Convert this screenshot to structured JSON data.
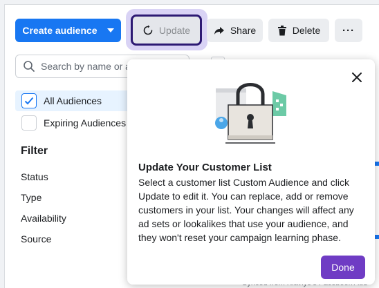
{
  "toolbar": {
    "create_label": "Create audience",
    "update_label": "Update",
    "share_label": "Share",
    "delete_label": "Delete",
    "more_label": "···"
  },
  "search": {
    "placeholder": "Search by name or a"
  },
  "audience_list": {
    "items": [
      {
        "label": "All Audiences",
        "checked": true
      },
      {
        "label": "Expiring Audiences",
        "checked": false
      }
    ]
  },
  "filter": {
    "title": "Filter",
    "items": [
      "Status",
      "Type",
      "Availability",
      "Source"
    ]
  },
  "popover": {
    "title": "Update Your Customer List",
    "body": "Select a customer list Custom Audience and click Update to edit it. You can replace, add or remove customers in your list. Your changes will affect any ad sets or lookalikes that use your audience, and they won't reset your campaign learning phase.",
    "done_label": "Done"
  },
  "background_hint": {
    "text": "Synced from Klaviyo's Facebook Aud"
  },
  "colors": {
    "primary": "#1877f2",
    "done_button": "#6f3cc4",
    "update_outline": "#2d1a73",
    "highlight": "#d9d3f5"
  }
}
